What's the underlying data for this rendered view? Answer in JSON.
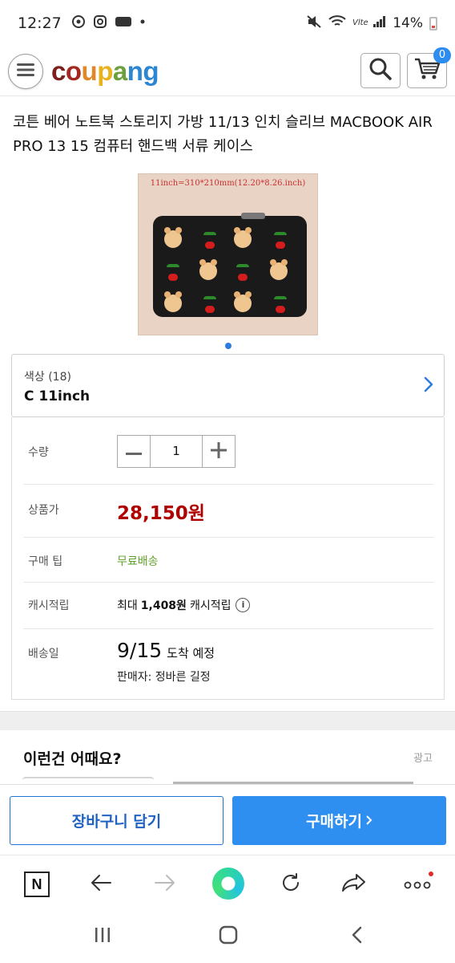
{
  "status_bar": {
    "time": "12:27",
    "battery": "14%",
    "battery_level": 0.14
  },
  "header": {
    "logo_letters": [
      "c",
      "o",
      "u",
      "p",
      "a",
      "n",
      "g"
    ],
    "logo_colors": [
      "#7b1f1f",
      "#a3281f",
      "#e0872a",
      "#e9b320",
      "#6ba03b",
      "#2c86d1",
      "#2c86d1"
    ],
    "cart_count": "0"
  },
  "product": {
    "title": "코튼 베어 노트북 스토리지 가방 11/13 인치 슬리브 MACBOOK AIR PRO 13 15 컴퓨터 핸드백 서류 케이스",
    "image_caption": "11inch=310*210mm(12.20*8.26.inch)",
    "image_count": 1,
    "current_image": 1
  },
  "option": {
    "label": "색상 (18)",
    "value": "C 11inch"
  },
  "details": {
    "quantity_label": "수량",
    "quantity_value": "1",
    "price_label": "상품가",
    "price": "28,150원",
    "tip_label": "구매 팁",
    "tip_value": "무료배송",
    "cash_label": "캐시적립",
    "cash_prefix": "최대",
    "cash_amount": "1,408원",
    "cash_suffix": "캐시적립",
    "delivery_label": "배송일",
    "delivery_date": "9/15",
    "delivery_suffix": "도착 예정",
    "seller": "판매자: 정바른 길정"
  },
  "recommend": {
    "title": "이런건 어때요?",
    "ad_label": "광고"
  },
  "actions": {
    "cart_button": "장바구니 담기",
    "buy_button": "구매하기"
  },
  "colors": {
    "accent_blue": "#2f8ff0",
    "price_red": "#ae0000",
    "free_green": "#5fa22b"
  }
}
